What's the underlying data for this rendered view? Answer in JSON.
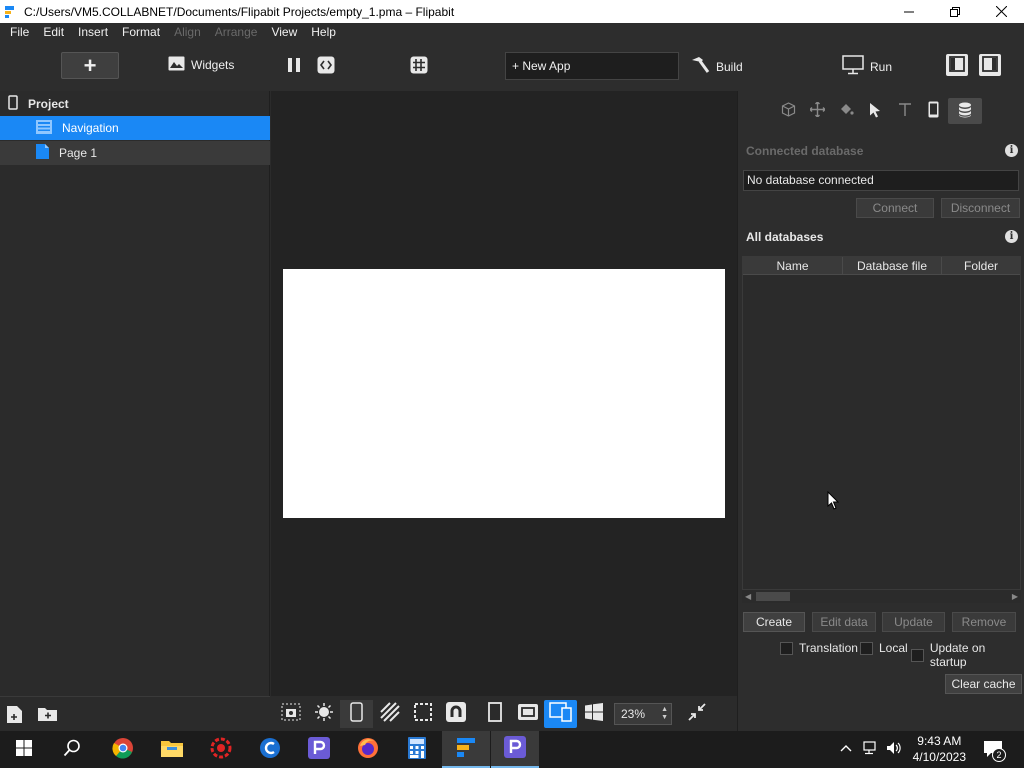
{
  "window": {
    "title": "C:/Users/VM5.COLLABNET/Documents/Flipabit Projects/empty_1.pma – Flipabit"
  },
  "menu": [
    {
      "label": "File",
      "enabled": true
    },
    {
      "label": "Edit",
      "enabled": true
    },
    {
      "label": "Insert",
      "enabled": true
    },
    {
      "label": "Format",
      "enabled": true
    },
    {
      "label": "Align",
      "enabled": false
    },
    {
      "label": "Arrange",
      "enabled": false
    },
    {
      "label": "View",
      "enabled": true
    },
    {
      "label": "Help",
      "enabled": true
    }
  ],
  "toolbar": {
    "add_label": "+",
    "widgets_label": "Widgets",
    "new_app_label": "+ New App",
    "build_label": "Build",
    "run_label": "Run"
  },
  "project": {
    "header": "Project",
    "items": [
      {
        "label": "Navigation",
        "selected": true
      },
      {
        "label": "Page 1",
        "selected": false
      }
    ]
  },
  "canvas_toolbar": {
    "zoom": "23%"
  },
  "database_panel": {
    "connected_title": "Connected database",
    "connected_value": "No database connected",
    "connect_label": "Connect",
    "disconnect_label": "Disconnect",
    "all_title": "All databases",
    "columns": [
      "Name",
      "Database file",
      "Folder"
    ],
    "create_label": "Create",
    "edit_label": "Edit data",
    "update_label": "Update",
    "remove_label": "Remove",
    "options": [
      "Translation",
      "Local",
      "Update on startup"
    ],
    "clear_cache_label": "Clear cache"
  },
  "taskbar": {
    "time": "9:43 AM",
    "date": "4/10/2023",
    "notification_count": "2"
  },
  "colors": {
    "accent": "#1a88f5",
    "panel": "#2d2d2d",
    "canvas": "#232323"
  }
}
